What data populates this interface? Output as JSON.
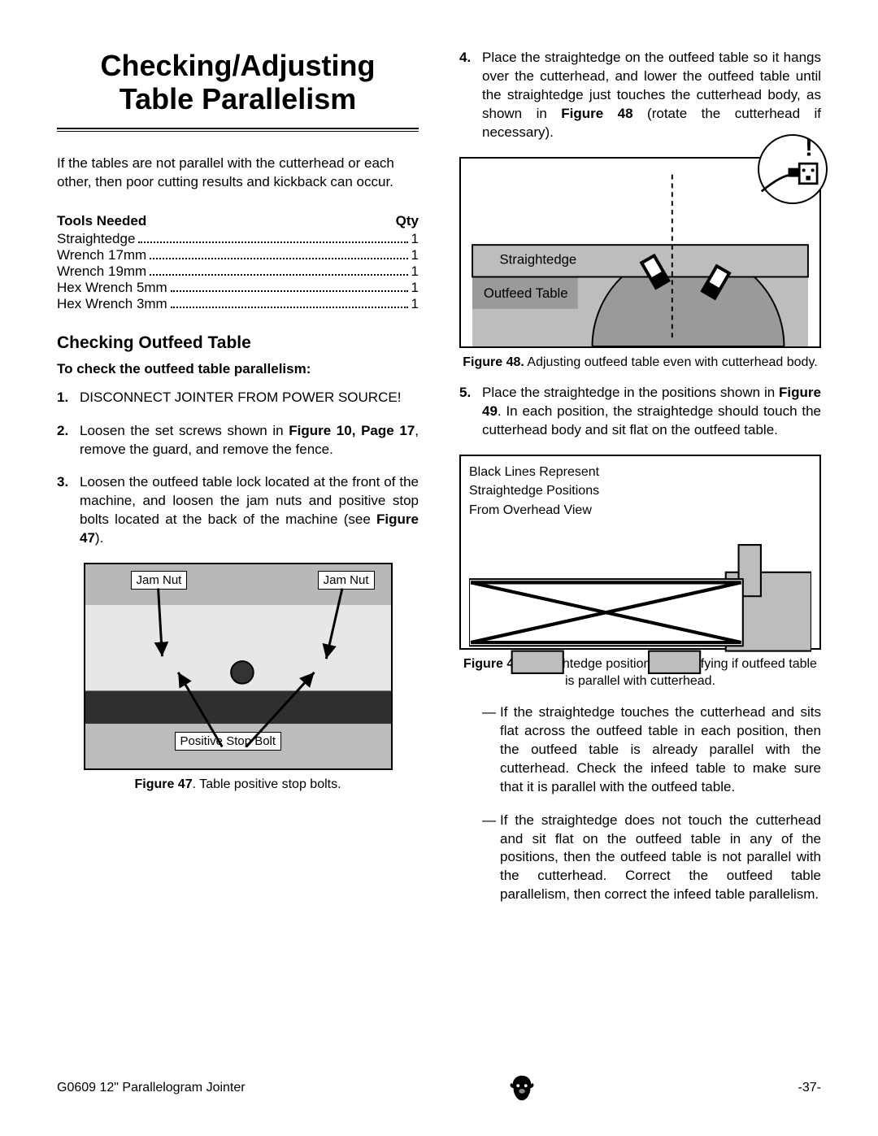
{
  "title_l1": "Checking/Adjusting",
  "title_l2": "Table Parallelism",
  "intro": "If the tables are not parallel with the cutterhead or each other, then poor cutting results and kickback can occur.",
  "tools": {
    "header_name": "Tools Needed",
    "header_qty": "Qty",
    "rows": [
      {
        "name": "Straightedge",
        "qty": "1"
      },
      {
        "name": "Wrench 17mm",
        "qty": "1"
      },
      {
        "name": "Wrench 19mm",
        "qty": "1"
      },
      {
        "name": "Hex Wrench 5mm",
        "qty": "1"
      },
      {
        "name": "Hex Wrench 3mm",
        "qty": "1"
      }
    ]
  },
  "section1": {
    "heading": "Checking Outfeed Table",
    "subhead": "To check the outfeed table parallelism:",
    "steps": {
      "s1": {
        "num": "1.",
        "text": "DISCONNECT JOINTER FROM POWER SOURCE!"
      },
      "s2": {
        "num": "2.",
        "pre": "Loosen the set screws shown in ",
        "b1": "Figure 10, Page 17",
        "post": ", remove the guard, and remove the fence."
      },
      "s3": {
        "num": "3.",
        "pre": "Loosen the outfeed table lock located at the front of the machine, and loosen the jam nuts and positive stop bolts located at the back of the machine (see ",
        "b1": "Figure 47",
        "post": ")."
      }
    }
  },
  "fig47": {
    "label1": "Jam Nut",
    "label2": "Jam Nut",
    "label3": "Positive Stop Bolt",
    "cap_b": "Figure 47",
    "cap": ". Table positive stop bolts."
  },
  "right": {
    "s4": {
      "num": "4.",
      "pre": "Place the straightedge on the outfeed table so it hangs over the cutterhead, and lower the outfeed table until the straightedge just touches the cutterhead body, as shown in ",
      "b1": "Figure 48",
      "post": " (rotate the cutterhead if necessary)."
    },
    "s5": {
      "num": "5.",
      "pre": "Place the straightedge in the positions shown in ",
      "b1": "Figure 49",
      "post": ". In each position, the straightedge should touch the cutterhead body and sit flat on the outfeed table."
    }
  },
  "fig48": {
    "bang": "!",
    "l1": "Straightedge",
    "l2": "Outfeed Table",
    "cap_b": "Figure 48.",
    "cap": " Adjusting outfeed table even with cutterhead body."
  },
  "fig49": {
    "note1": "Black Lines Represent",
    "note2": "Straightedge Positions",
    "note3": "From Overhead View",
    "cap_b": "Figure 49.",
    "cap": " Straightedge positions for verifying if outfeed table is parallel with cutterhead."
  },
  "dashes": {
    "d1": "If the straightedge touches the cutterhead and sits flat across the outfeed table in each position, then the outfeed table is already parallel with the cutterhead. Check the infeed table to make sure that it is parallel with the outfeed table.",
    "d2": "If the straightedge does not touch the cutterhead and sit flat on the outfeed table in any of the positions, then the outfeed table is not parallel with the cutterhead. Correct the outfeed table parallelism, then correct the infeed table parallelism."
  },
  "footer": {
    "left": "G0609 12\" Parallelogram Jointer",
    "right": "-37-"
  }
}
